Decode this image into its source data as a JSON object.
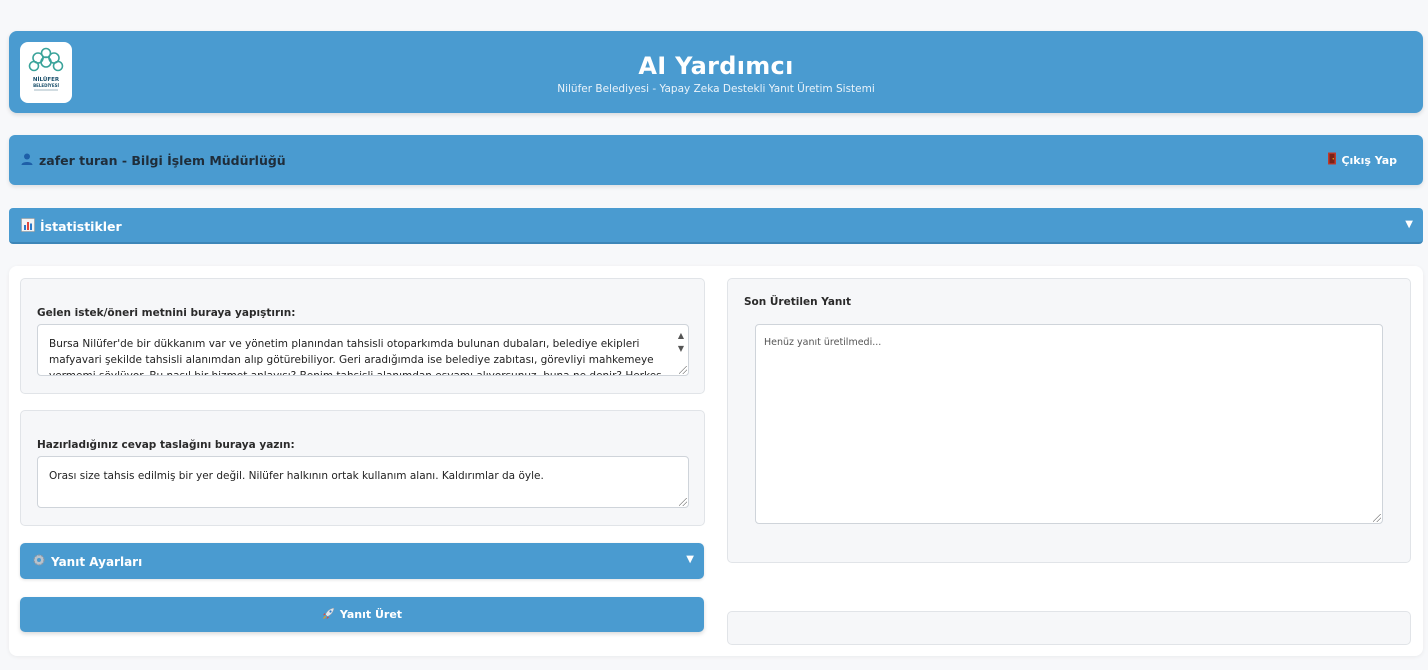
{
  "header": {
    "title": "AI Yardımcı",
    "subtitle": "Nilüfer Belediyesi - Yapay Zeka Destekli Yanıt Üretim Sistemi",
    "logo_text": "NİLÜFER BELEDİYESİ"
  },
  "user": {
    "icon": "user-icon",
    "label": "zafer turan - Bilgi İşlem Müdürlüğü",
    "logout_icon": "door-icon",
    "logout_label": "Çıkış Yap"
  },
  "stats": {
    "icon": "bar-chart-icon",
    "label": "İstatistikler",
    "collapsed": true
  },
  "request": {
    "label": "Gelen istek/öneri metnini buraya yapıştırın:",
    "value": "Bursa Nilüfer'de bir dükkanım var ve yönetim planından tahsisli otoparkımda bulunan dubaları, belediye ekipleri mafyavari şekilde tahsisli alanımdan alıp götürebiliyor. Geri aradığımda ise belediye zabıtası, görevliyi mahkemeye vermemi söylüyor. Bu nasıl bir hizmet anlayışı? Benim tahsisli alanımdan eşyamı alıyorsunuz, buna ne denir? Herkes biliyordur. Bir yeri koruduğunu"
  },
  "draft": {
    "label": "Hazırladığınız cevap taslağını buraya yazın:",
    "value": "Orası size tahsis edilmiş bir yer değil. Nilüfer halkının ortak kullanım alanı. Kaldırımlar da öyle."
  },
  "settings": {
    "icon": "gear-icon",
    "label": "Yanıt Ayarları"
  },
  "generate": {
    "icon": "rocket-icon",
    "label": "Yanıt Üret"
  },
  "response": {
    "label": "Son Üretilen Yanıt",
    "placeholder": "Henüz yanıt üretilmedi..."
  },
  "colors": {
    "accent": "#4a9bd0",
    "background": "#f7f8fa"
  }
}
